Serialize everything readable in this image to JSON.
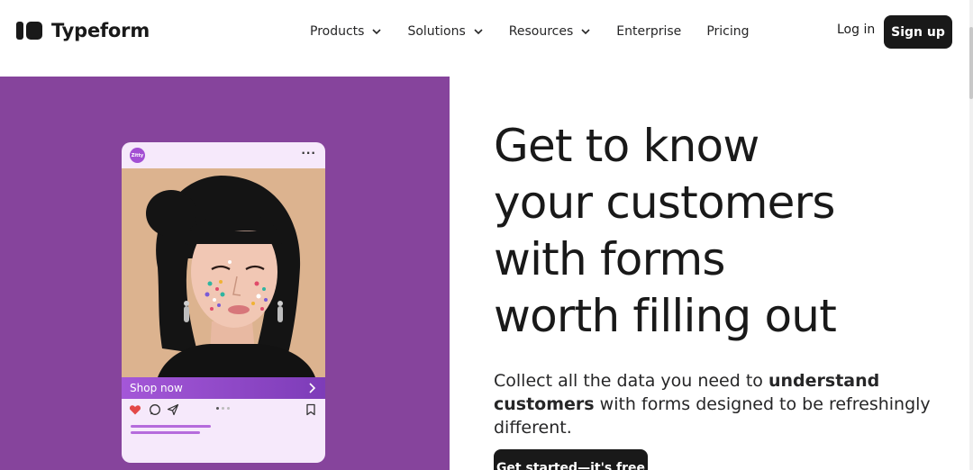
{
  "brand": {
    "name": "Typeform"
  },
  "nav": {
    "items": [
      {
        "label": "Products",
        "has_dropdown": true
      },
      {
        "label": "Solutions",
        "has_dropdown": true
      },
      {
        "label": "Resources",
        "has_dropdown": true
      },
      {
        "label": "Enterprise",
        "has_dropdown": false
      },
      {
        "label": "Pricing",
        "has_dropdown": false
      }
    ],
    "login_label": "Log in",
    "signup_label": "Sign up"
  },
  "hero": {
    "title_lines": [
      "Get to know",
      "your customers",
      "with forms",
      "worth filling out"
    ],
    "subtitle_before": "Collect all the data you need to ",
    "subtitle_bold": "understand customers",
    "subtitle_after": " with forms designed to be refreshingly different.",
    "cta_label": "Get started—it's free"
  },
  "phone_card": {
    "avatar_text": "Zitty",
    "more_icon": "ellipsis-icon",
    "shop_label": "Shop now",
    "action_icons": [
      "heart-icon",
      "comment-icon",
      "send-icon",
      "bookmark-icon"
    ]
  },
  "colors": {
    "panel": "#86449c",
    "accent": "#a457d8",
    "dark": "#191919"
  }
}
